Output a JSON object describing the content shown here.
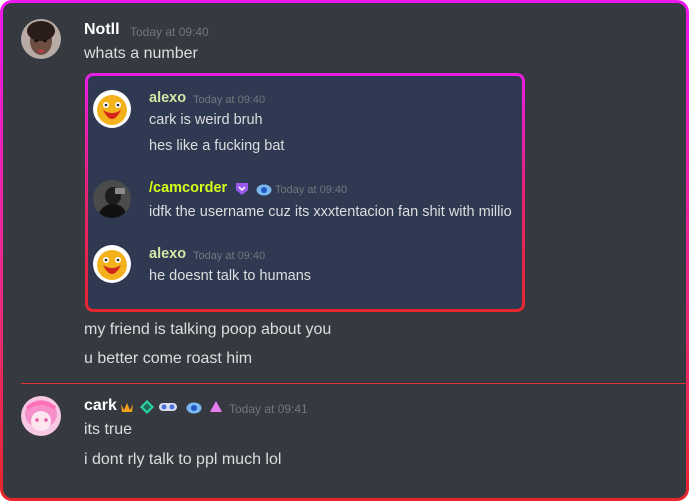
{
  "messages": {
    "notll": {
      "username": "Notll",
      "timestamp": "Today at 09:40",
      "lines": [
        "whats a number"
      ],
      "after_quote": [
        "my friend is talking poop about you",
        "u better come roast him"
      ],
      "color": "#ffffff"
    },
    "quote": {
      "alexo_1": {
        "username": "alexo",
        "timestamp": "Today at 09:40",
        "lines": [
          "cark is weird bruh",
          "hes like a fucking bat"
        ],
        "color": "#cfe8a5"
      },
      "camcorder": {
        "username": "/camcorder",
        "timestamp": "Today at 09:40",
        "lines": [
          "idfk the username cuz its xxxtentacion fan shit with millio"
        ],
        "color": "#d6ff1a"
      },
      "alexo_2": {
        "username": "alexo",
        "timestamp": "Today at 09:40",
        "lines": [
          "he doesnt talk to humans"
        ],
        "color": "#cfe8a5"
      }
    },
    "cark": {
      "username": "cark",
      "timestamp": "Today at 09:41",
      "lines": [
        "its true",
        "i dont rly talk to ppl much lol"
      ],
      "color": "#ffffff"
    }
  },
  "icons": {
    "camcorder_badges": [
      "shield-badge-icon",
      "nitro-badge-icon"
    ],
    "cark_badges": [
      "hypesquad-badge-icon",
      "boost-badge-icon",
      "goggles-badge-icon",
      "nitro-badge-icon",
      "triangle-badge-icon"
    ]
  },
  "colors": {
    "background": "#36393f",
    "quote_background": "#2f3a52",
    "frame_gradient_top": "#ee17ee",
    "frame_gradient_bottom": "#e8262a",
    "timestamp": "#72767d",
    "text": "#dcddde"
  }
}
